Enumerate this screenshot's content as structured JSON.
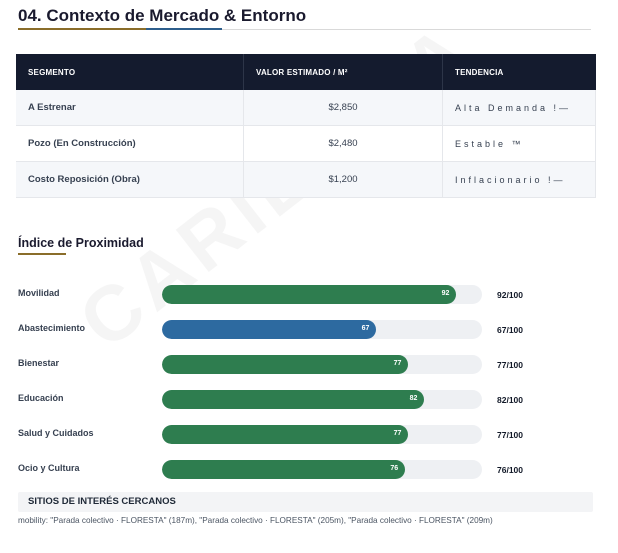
{
  "section_title": "04. Contexto de Mercado & Entorno",
  "watermark": "CARIES VA",
  "colors": {
    "green": "#2e7d4f",
    "blue": "#2d6aa0",
    "header_bg": "#141b2e",
    "gold": "#8a6d2a"
  },
  "market_table": {
    "headers": [
      "SEGMENTO",
      "VALOR ESTIMADO / M²",
      "TENDENCIA"
    ],
    "rows": [
      {
        "segment": "A Estrenar",
        "value": "$2,850",
        "trend": "Alta Demanda !—"
      },
      {
        "segment": "Pozo (En Construcción)",
        "value": "$2,480",
        "trend": "Estable ™"
      },
      {
        "segment": "Costo Reposición (Obra)",
        "value": "$1,200",
        "trend": "Inflacionario !—"
      }
    ]
  },
  "proximity": {
    "title": "Índice de Proximidad",
    "items": [
      {
        "label": "Movilidad",
        "value": 92,
        "bar_label": "92",
        "score": "92/100",
        "color": "green"
      },
      {
        "label": "Abastecimiento",
        "value": 67,
        "bar_label": "67",
        "score": "67/100",
        "color": "blue"
      },
      {
        "label": "Bienestar",
        "value": 77,
        "bar_label": "77",
        "score": "77/100",
        "color": "green"
      },
      {
        "label": "Educación",
        "value": 82,
        "bar_label": "82",
        "score": "82/100",
        "color": "green"
      },
      {
        "label": "Salud y Cuidados",
        "value": 77,
        "bar_label": "77",
        "score": "77/100",
        "color": "green"
      },
      {
        "label": "Ocio y Cultura",
        "value": 76,
        "bar_label": "76",
        "score": "76/100",
        "color": "green"
      }
    ]
  },
  "sites": {
    "title": "SITIOS DE INTERÉS CERCANOS",
    "text": "mobility: \"Parada colectivo · FLORESTA\" (187m), \"Parada colectivo · FLORESTA\" (205m), \"Parada colectivo · FLORESTA\" (209m)"
  }
}
